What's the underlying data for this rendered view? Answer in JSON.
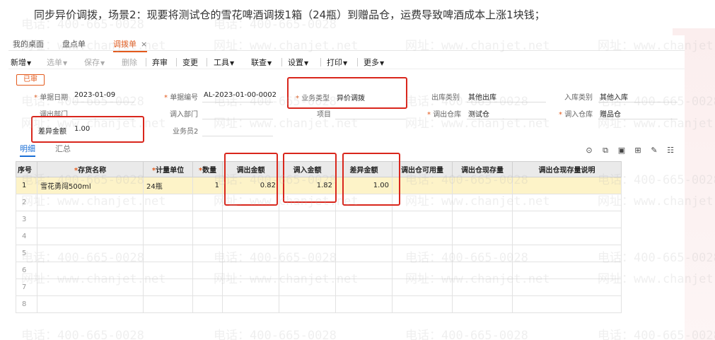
{
  "caption": "同步异价调拨，场景2：现要将测试仓的雪花啤酒调拨1箱（24瓶）到赠品仓，运费导致啤酒成本上涨1块钱；",
  "tabs": [
    {
      "label": "我的桌面"
    },
    {
      "label": "盘点单"
    },
    {
      "label": "调拨单",
      "close": "×"
    }
  ],
  "toolbar": {
    "new": "新增",
    "select": "选单",
    "save": "保存",
    "delete": "删除",
    "abandon": "弃审",
    "change": "变更",
    "tools": "工具",
    "link": "联查",
    "settings": "设置",
    "print": "打印",
    "more": "更多"
  },
  "status_badge": "已审",
  "form": {
    "doc_date_label": "单据日期",
    "doc_date": "2023-01-09",
    "doc_no_label": "单据编号",
    "doc_no": "AL-2023-01-00-0002",
    "biz_type_label": "业务类型",
    "biz_type": "异价调拨",
    "out_type_label": "出库类别",
    "out_type": "其他出库",
    "in_type_label": "入库类别",
    "in_type": "其他入库",
    "out_dept_label": "调出部门",
    "in_dept_label": "调入部门",
    "project_label": "项目",
    "out_wh_label": "调出仓库",
    "out_wh": "测试仓",
    "in_wh_label": "调入仓库",
    "in_wh": "赠品仓",
    "diff_label": "差异金额",
    "diff": "1.00",
    "clerk2_label": "业务员2"
  },
  "subtabs": {
    "detail": "明细",
    "summary": "汇总"
  },
  "table": {
    "headers": [
      "序号",
      "存货名称",
      "计量单位",
      "数量",
      "调出金额",
      "调入金额",
      "差异金额",
      "调出仓可用量",
      "调出仓现存量",
      "调出仓现存量说明"
    ],
    "row1": {
      "idx": "1",
      "name": "雪花勇闯500ml",
      "unit": "24瓶",
      "qty": "1",
      "out_amt": "0.82",
      "in_amt": "1.82",
      "diff_amt": "1.00"
    },
    "idx": [
      "2",
      "3",
      "4",
      "5",
      "6",
      "7",
      "8"
    ]
  },
  "watermark": {
    "phone": "电话：400-665-0028",
    "web": "网址：www.chanjet.net"
  },
  "colors": {
    "accent": "#e35a1c",
    "highlight": "#d9261c",
    "selected_row": "#fdf3c8",
    "tab_blue": "#1a6fd6"
  }
}
